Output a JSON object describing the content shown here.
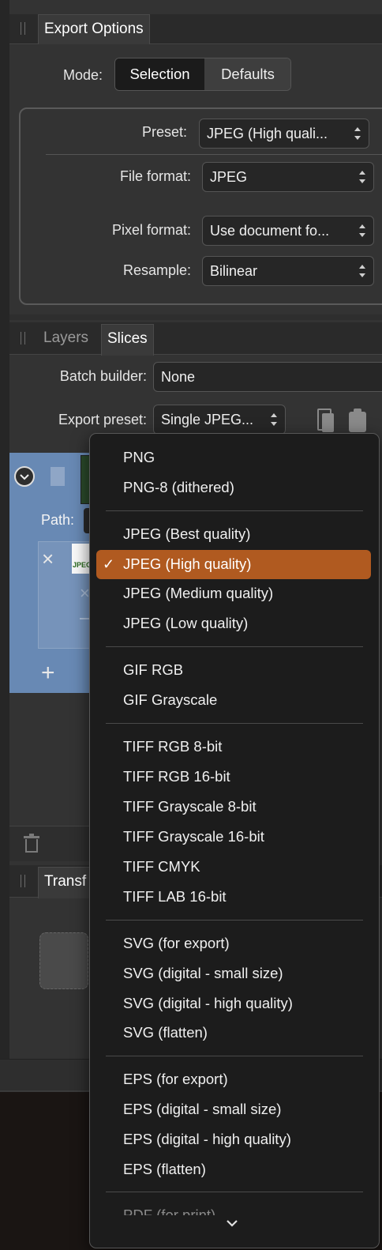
{
  "export_options": {
    "tab_label": "Export Options",
    "mode_label": "Mode:",
    "mode_options": [
      "Selection",
      "Defaults"
    ],
    "preset_label": "Preset:",
    "preset_value": "JPEG (High quali...",
    "file_format_label": "File format:",
    "file_format_value": "JPEG",
    "pixel_format_label": "Pixel format:",
    "pixel_format_value": "Use document fo...",
    "resample_label": "Resample:",
    "resample_value": "Bilinear"
  },
  "slices_panel": {
    "tabs": [
      "Layers",
      "Slices"
    ],
    "batch_builder_label": "Batch builder:",
    "batch_builder_value": "None",
    "export_preset_label": "Export preset:",
    "export_preset_value": "Single JPEG...",
    "path_label": "Path:",
    "thumb_text": "JPEG"
  },
  "transform_panel": {
    "tab_label": "Transf"
  },
  "dropdown": {
    "groups": [
      [
        "PNG",
        "PNG-8 (dithered)"
      ],
      [
        "JPEG (Best quality)",
        "JPEG (High quality)",
        "JPEG (Medium quality)",
        "JPEG (Low quality)"
      ],
      [
        "GIF RGB",
        "GIF Grayscale"
      ],
      [
        "TIFF RGB 8-bit",
        "TIFF RGB 16-bit",
        "TIFF Grayscale 8-bit",
        "TIFF Grayscale 16-bit",
        "TIFF CMYK",
        "TIFF LAB 16-bit"
      ],
      [
        "SVG (for export)",
        "SVG (digital - small size)",
        "SVG (digital - high quality)",
        "SVG (flatten)"
      ],
      [
        "EPS (for export)",
        "EPS (digital - small size)",
        "EPS (digital - high quality)",
        "EPS (flatten)"
      ]
    ],
    "selected": "JPEG (High quality)",
    "check_mark": "✓",
    "cut_off_item": "PDF (for print)",
    "scroll_indicator": "chevron-down-icon"
  }
}
